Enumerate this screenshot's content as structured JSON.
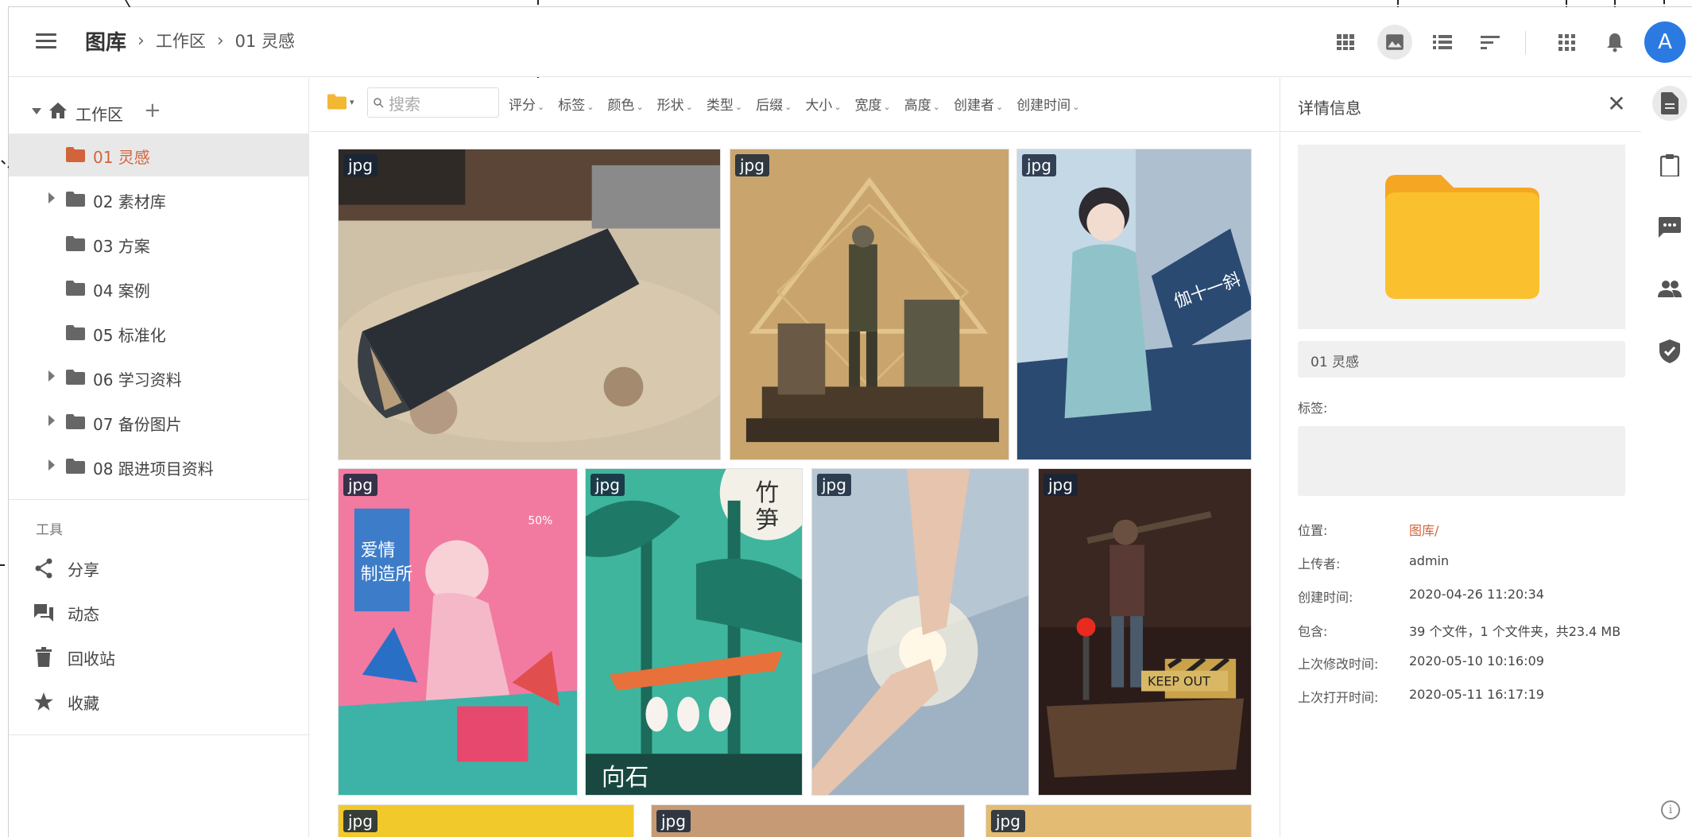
{
  "app": {
    "breadcrumb": {
      "root": "图库",
      "items": [
        "工作区",
        "01 灵感"
      ]
    }
  },
  "toolbar": {
    "icons": [
      "grid-view-icon",
      "image-view-icon",
      "list-view-icon",
      "sort-icon",
      "apps-icon",
      "bell-icon"
    ],
    "avatar_letter": "A"
  },
  "sidebar": {
    "workspace": {
      "label": "工作区",
      "add": "+"
    },
    "folders": [
      {
        "label": "01 灵感",
        "selected": true,
        "expandable": false
      },
      {
        "label": "02 素材库",
        "selected": false,
        "expandable": true
      },
      {
        "label": "03 方案",
        "selected": false,
        "expandable": false
      },
      {
        "label": "04 案例",
        "selected": false,
        "expandable": false
      },
      {
        "label": "05 标准化",
        "selected": false,
        "expandable": false
      },
      {
        "label": "06 学习资料",
        "selected": false,
        "expandable": true
      },
      {
        "label": "07 备份图片",
        "selected": false,
        "expandable": true
      },
      {
        "label": "08 跟进项目资料",
        "selected": false,
        "expandable": true
      }
    ],
    "tools_title": "工具",
    "tools": [
      {
        "label": "分享",
        "icon": "share-icon"
      },
      {
        "label": "动态",
        "icon": "activity-icon"
      },
      {
        "label": "回收站",
        "icon": "trash-icon"
      },
      {
        "label": "收藏",
        "icon": "star-icon"
      }
    ]
  },
  "filterbar": {
    "search_placeholder": "搜索",
    "filters": [
      "评分",
      "标签",
      "颜色",
      "形状",
      "类型",
      "后缀",
      "大小",
      "宽度",
      "高度",
      "创建者",
      "创建时间"
    ]
  },
  "gallery": {
    "badge": "jpg",
    "images": [
      {
        "subject": "speaker-on-granite"
      },
      {
        "subject": "soldier-diorama"
      },
      {
        "subject": "girl-illustration",
        "text": "伽十一斜"
      },
      {
        "subject": "pink-poster",
        "text": "爱情制造所"
      },
      {
        "subject": "bamboo-poster",
        "text": "竹笋"
      },
      {
        "subject": "hands-light"
      },
      {
        "subject": "warrior-figure",
        "text": "KEEP OUT"
      },
      {
        "subject": "yellow"
      },
      {
        "subject": "tan"
      },
      {
        "subject": "gold"
      }
    ]
  },
  "details": {
    "title": "详情信息",
    "close": "✕",
    "name": "01 灵感",
    "tags_label": "标签:",
    "rows": [
      {
        "key": "位置:",
        "value": "图库/",
        "link": true
      },
      {
        "key": "上传者:",
        "value": "admin"
      },
      {
        "key": "创建时间:",
        "value": "2020-04-26 11:20:34"
      },
      {
        "key": "包含:",
        "value": "39 个文件，1 个文件夹，共23.4 MB"
      },
      {
        "key": "上次修改时间:",
        "value": "2020-05-10 10:16:09"
      },
      {
        "key": "上次打开时间:",
        "value": "2020-05-11 16:17:19"
      }
    ],
    "folder_color": "#fbc02d"
  },
  "rail": {
    "icons": [
      "document-icon",
      "clipboard-icon",
      "comment-icon",
      "people-icon",
      "shield-check-icon"
    ],
    "info": "i"
  },
  "colors": {
    "accent": "#d2643b",
    "avatar": "#2a7ae2",
    "folder": "#fbc02d",
    "badge": "#16263a"
  }
}
